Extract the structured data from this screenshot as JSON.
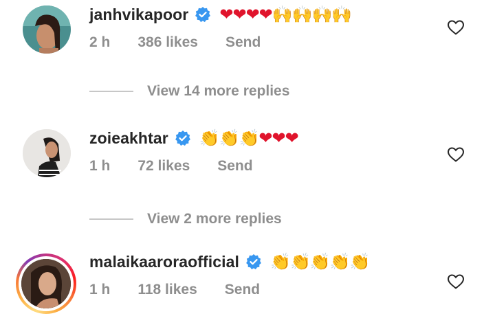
{
  "comments": [
    {
      "username": "janhvikapoor",
      "verified": true,
      "emojis": [
        "❤",
        "❤",
        "❤",
        "❤",
        "🙌",
        "🙌",
        "🙌",
        "🙌"
      ],
      "emoji_text_hearts": "❤❤❤❤",
      "emoji_text_claps": "🙌🙌🙌🙌",
      "time": "2 h",
      "likes": "386 likes",
      "send": "Send"
    },
    {
      "username": "zoieakhtar",
      "verified": true,
      "emoji_text_claps": "👏👏👏",
      "emoji_text_hearts": "❤❤❤",
      "time": "1 h",
      "likes": "72 likes",
      "send": "Send"
    },
    {
      "username": "malaikaaroraofficial",
      "verified": true,
      "emoji_text_claps": "👏👏👏👏👏",
      "time": "1 h",
      "likes": "118 likes",
      "send": "Send"
    }
  ],
  "replies": [
    {
      "label": "View 14 more replies"
    },
    {
      "label": "View 2 more replies"
    }
  ],
  "colors": {
    "text_primary": "#262626",
    "text_secondary": "#8e8e8e",
    "verified_blue": "#3897f0",
    "heart_red": "#e0142c"
  },
  "icons": {
    "verified": "verified-badge-icon",
    "like": "heart-outline-icon"
  }
}
